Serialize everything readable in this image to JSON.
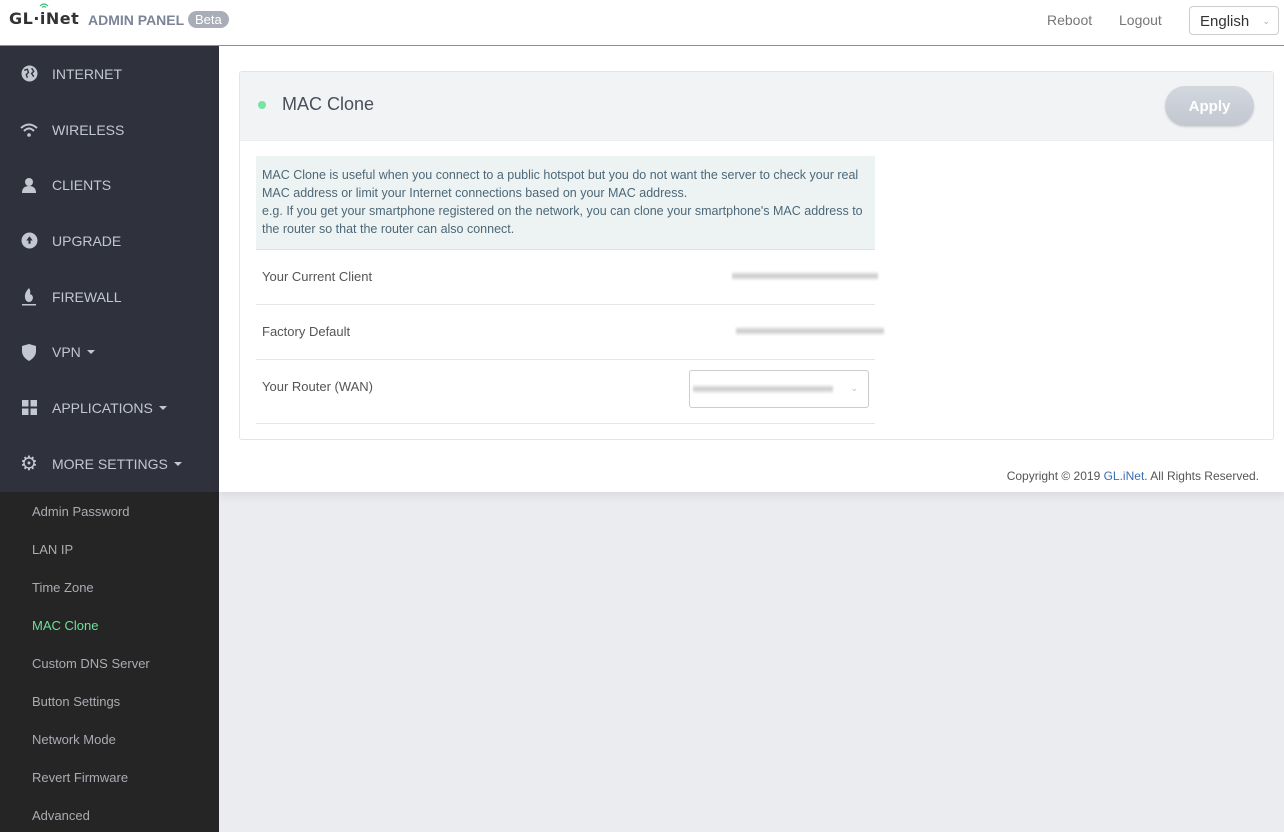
{
  "header": {
    "logo": "GL·iNet",
    "admin_title": "ADMIN PANEL",
    "beta_badge": "Beta",
    "reboot": "Reboot",
    "logout": "Logout",
    "language": "English"
  },
  "sidebar": {
    "items": [
      {
        "label": "INTERNET",
        "icon": "globe-icon",
        "dropdown": false
      },
      {
        "label": "WIRELESS",
        "icon": "wifi-icon",
        "dropdown": false
      },
      {
        "label": "CLIENTS",
        "icon": "user-icon",
        "dropdown": false
      },
      {
        "label": "UPGRADE",
        "icon": "upgrade-icon",
        "dropdown": false
      },
      {
        "label": "FIREWALL",
        "icon": "fire-icon",
        "dropdown": false
      },
      {
        "label": "VPN",
        "icon": "shield-icon",
        "dropdown": true
      },
      {
        "label": "APPLICATIONS",
        "icon": "grid-icon",
        "dropdown": true
      },
      {
        "label": "MORE SETTINGS",
        "icon": "gear-icon",
        "dropdown": true
      }
    ],
    "submenu": [
      {
        "label": "Admin Password",
        "active": false
      },
      {
        "label": "LAN IP",
        "active": false
      },
      {
        "label": "Time Zone",
        "active": false
      },
      {
        "label": "MAC Clone",
        "active": true
      },
      {
        "label": "Custom DNS Server",
        "active": false
      },
      {
        "label": "Button Settings",
        "active": false
      },
      {
        "label": "Network Mode",
        "active": false
      },
      {
        "label": "Revert Firmware",
        "active": false
      },
      {
        "label": "Advanced",
        "active": false
      }
    ]
  },
  "main": {
    "card_title": "MAC Clone",
    "apply_label": "Apply",
    "info_line1": "MAC Clone is useful when you connect to a public hotspot but you do not want the server to check your real MAC address or limit your Internet connections based on your MAC address.",
    "info_line2": "e.g. If you get your smartphone registered on the network, you can clone your smartphone's MAC address to the router so that the router can also connect.",
    "rows": [
      {
        "label": "Your Current Client",
        "value_redacted": true
      },
      {
        "label": "Factory Default",
        "value_redacted": true
      },
      {
        "label": "Your Router (WAN)",
        "value_redacted": true,
        "control": "select"
      }
    ],
    "status_color": "#78e3a6"
  },
  "footer": {
    "copyright_prefix": "Copyright © 2019 ",
    "brand_link": "GL.iNet",
    "copyright_suffix": ". All Rights Reserved."
  }
}
